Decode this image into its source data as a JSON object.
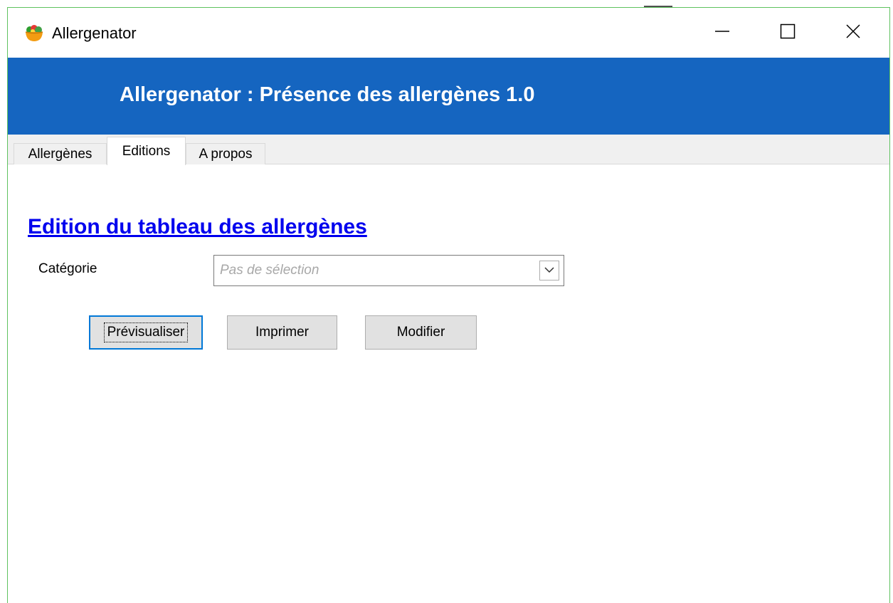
{
  "window": {
    "title": "Allergenator",
    "icon": "salad-bowl-icon",
    "controls": [
      "minimize-icon",
      "maximize-icon",
      "close-icon"
    ],
    "border_color": "#5fc25f"
  },
  "banner": {
    "title": "Allergenator : Présence des allergènes 1.0",
    "background": "#1565c0"
  },
  "tabs": [
    {
      "label": "Allergènes",
      "active": false
    },
    {
      "label": "Editions",
      "active": true
    },
    {
      "label": "A propos",
      "active": false
    }
  ],
  "main": {
    "section_title": "Edition du tableau des allergènes",
    "category": {
      "label": "Catégorie",
      "placeholder": "Pas de sélection",
      "value": ""
    },
    "buttons": {
      "preview": "Prévisualiser",
      "print": "Imprimer",
      "modify": "Modifier"
    }
  },
  "colors": {
    "link": "#0000ee",
    "focus": "#0078d7"
  }
}
